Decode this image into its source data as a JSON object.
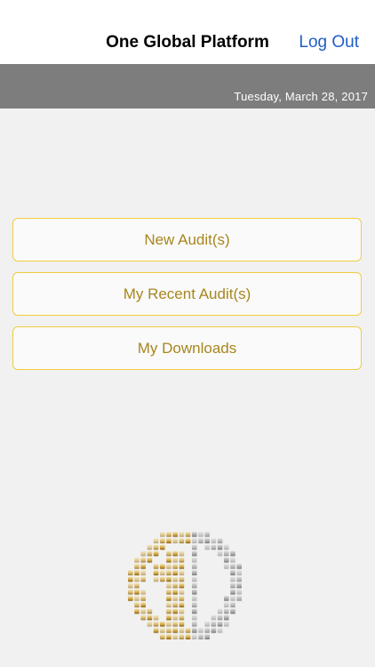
{
  "header": {
    "title": "One Global Platform",
    "logout_label": "Log Out"
  },
  "date_bar": {
    "date": "Tuesday, March 28, 2017"
  },
  "menu": {
    "items": [
      {
        "label": "New Audit(s)"
      },
      {
        "label": "My Recent Audit(s)"
      },
      {
        "label": "My Downloads"
      }
    ]
  },
  "logo": {
    "icon": "globe-one-logo-icon"
  },
  "colors": {
    "accent_gold": "#a8861e",
    "button_border": "#f2cd3c",
    "link_blue": "#1f5ec8",
    "date_bar_bg": "#7d7d7d"
  }
}
